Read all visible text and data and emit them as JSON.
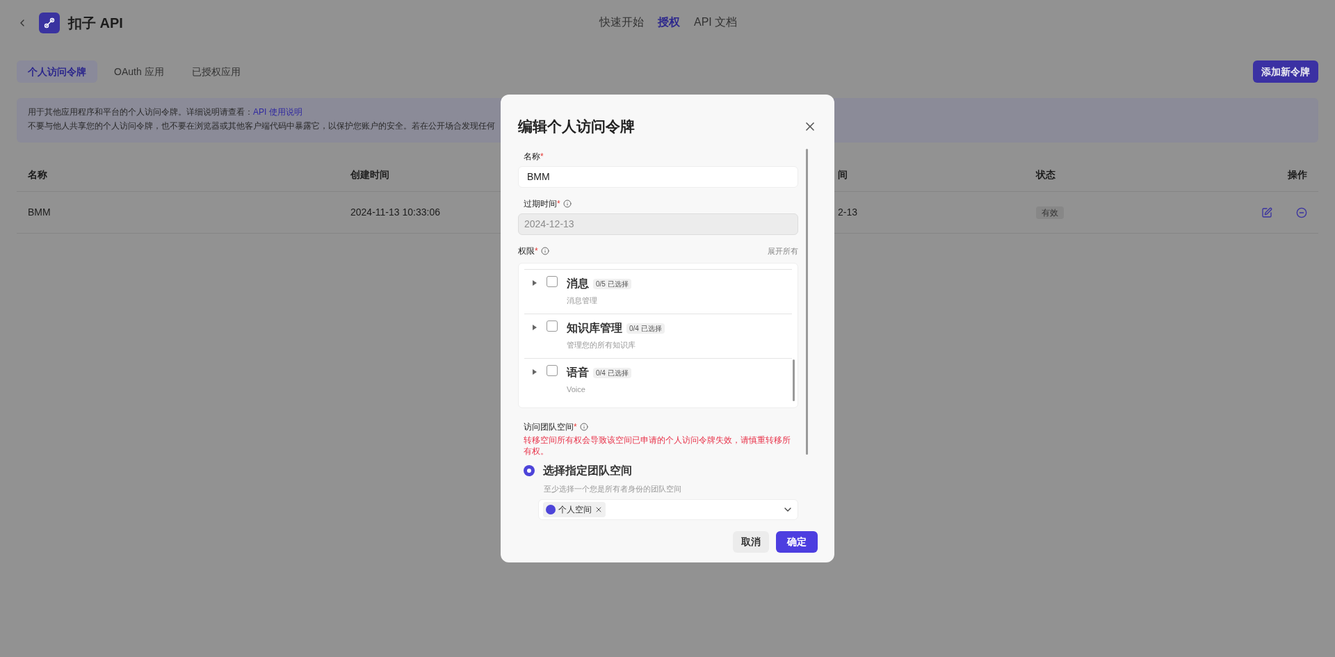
{
  "header": {
    "title": "扣子 API",
    "nav": [
      {
        "label": "快速开始",
        "selected": false
      },
      {
        "label": "授权",
        "selected": true
      },
      {
        "label": "API 文档",
        "selected": false
      }
    ]
  },
  "tabs": [
    {
      "label": "个人访问令牌",
      "selected": true
    },
    {
      "label": "OAuth 应用",
      "selected": false
    },
    {
      "label": "已授权应用",
      "selected": false
    }
  ],
  "add_button": "添加新令牌",
  "notice": {
    "line_1": "用于其他应用程序和平台的个人访问令牌。详细说明请查看：",
    "link": "API 使用说明",
    "line_2": "不要与他人共享您的个人访问令牌，也不要在浏览器或其他客户端代码中暴露它，以保护您账户的安全。若在公开场合发现任何"
  },
  "table": {
    "columns": [
      "名称",
      "创建时间",
      "间",
      "状态",
      "操作"
    ],
    "rows": [
      {
        "name": "BMM",
        "created": "2024-11-13 10:33:06",
        "column_3": "2-13",
        "status": "有效"
      }
    ]
  },
  "dialog": {
    "title": "编辑个人访问令牌",
    "name_field": {
      "label": "名称",
      "required_mark": "*",
      "value": "BMM"
    },
    "expiry_field": {
      "label": "过期时间",
      "required_mark": "*",
      "value": "2024-12-13",
      "disabled": true
    },
    "permissions": {
      "label": "权限",
      "required_mark": "*",
      "expand_all": "展开所有",
      "items": [
        {
          "title": "消息",
          "count": "0/5 已选择",
          "description": "消息管理",
          "checked": false
        },
        {
          "title": "知识库管理",
          "count": "0/4 已选择",
          "description": "管理您的所有知识库",
          "checked": false
        },
        {
          "title": "语音",
          "count": "0/4 已选择",
          "description": "Voice",
          "checked": false
        }
      ]
    },
    "team_space": {
      "label": "访问团队空间",
      "required_mark": "*",
      "warning": "转移空间所有权会导致该空间已申请的个人访问令牌失效，请慎重转移所有权。",
      "option": {
        "label": "选择指定团队空间",
        "selected": true,
        "hint": "至少选择一个您是所有者身份的团队空间"
      },
      "tags": [
        "个人空间"
      ]
    },
    "buttons": {
      "cancel": "取消",
      "confirm": "确定"
    }
  }
}
